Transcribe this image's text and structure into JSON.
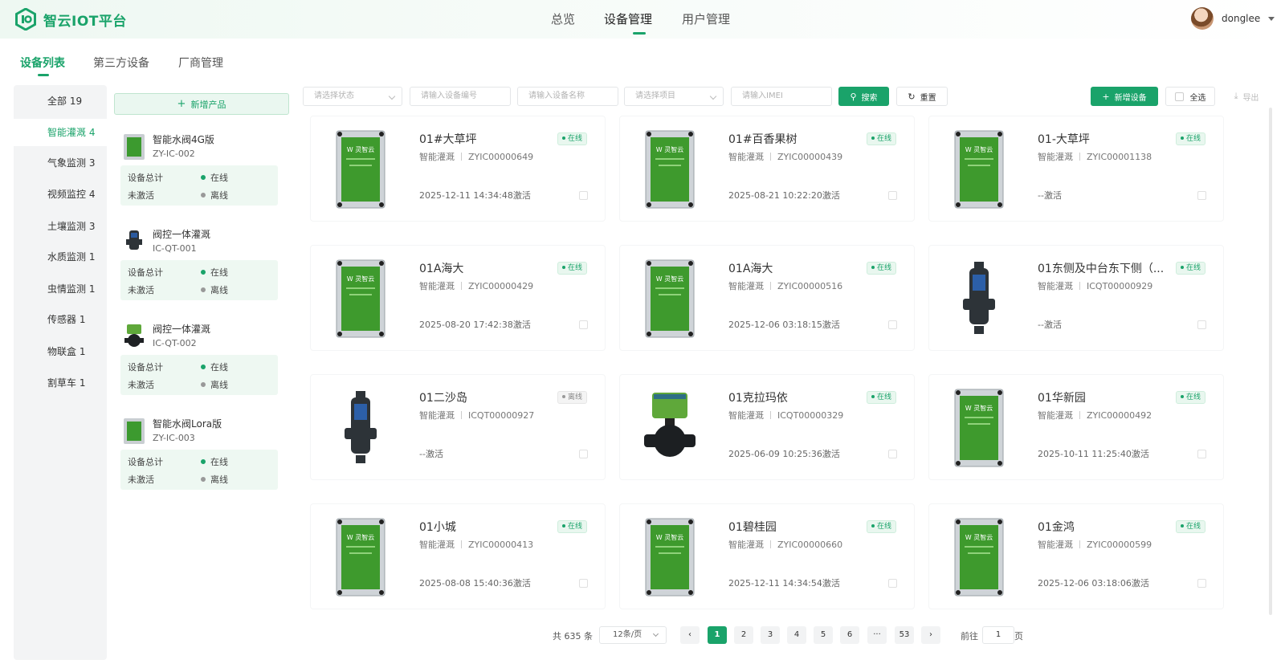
{
  "app": {
    "logo_text": "智云IOT平台",
    "accent": "#1aa36a"
  },
  "nav": {
    "items": [
      "总览",
      "设备管理",
      "用户管理"
    ],
    "active": "设备管理"
  },
  "user": {
    "name": "donglee"
  },
  "subtabs": {
    "items": [
      "设备列表",
      "第三方设备",
      "厂商管理"
    ],
    "active": "设备列表"
  },
  "categories": [
    {
      "label": "全部 19"
    },
    {
      "label": "智能灌溉 4",
      "active": true
    },
    {
      "label": "气象监测 3"
    },
    {
      "label": "视频监控 4"
    },
    {
      "label": "土壤监测 3"
    },
    {
      "label": "水质监测 1"
    },
    {
      "label": "虫情监测 1"
    },
    {
      "label": "传感器 1"
    },
    {
      "label": "物联盒 1"
    },
    {
      "label": "割草车 1"
    }
  ],
  "products": {
    "add_label": "新增产品",
    "items": [
      {
        "name": "智能水阀4G版",
        "code": "ZY-IC-002",
        "total_label": "设备总计",
        "inactive_label": "未激活",
        "online_label": "在线",
        "offline_label": "离线",
        "icon": "controller-box-icon"
      },
      {
        "name": "阀控一体灌溉",
        "code": "IC-QT-001",
        "total_label": "设备总计",
        "inactive_label": "未激活",
        "online_label": "在线",
        "offline_label": "离线",
        "icon": "valve-icon"
      },
      {
        "name": "阀控一体灌溉",
        "code": "IC-QT-002",
        "total_label": "设备总计",
        "inactive_label": "未激活",
        "online_label": "在线",
        "offline_label": "离线",
        "icon": "ball-valve-icon"
      },
      {
        "name": "智能水阀Lora版",
        "code": "ZY-IC-003",
        "total_label": "设备总计",
        "inactive_label": "未激活",
        "online_label": "在线",
        "offline_label": "离线",
        "icon": "controller-box-icon"
      }
    ]
  },
  "filters": {
    "status_placeholder": "请选择状态",
    "device_no_placeholder": "请输入设备编号",
    "device_name_placeholder": "请输入设备名称",
    "project_placeholder": "请选择项目",
    "imei_placeholder": "请输入IMEI",
    "search_label": "搜索",
    "reset_label": "重置",
    "add_device_label": "新增设备",
    "select_all_label": "全选",
    "export_label": "导出"
  },
  "devices": [
    {
      "title": "01#大草坪",
      "category": "智能灌溉",
      "code": "ZYIC00000649",
      "activated": "2025-12-11 14:34:48激活",
      "status": "在线",
      "online": true,
      "image": "controller-box-icon"
    },
    {
      "title": "01#百香果树",
      "category": "智能灌溉",
      "code": "ZYIC00000439",
      "activated": "2025-08-21 10:22:20激活",
      "status": "在线",
      "online": true,
      "image": "controller-box-icon"
    },
    {
      "title": "01-大草坪",
      "category": "智能灌溉",
      "code": "ZYIC00001138",
      "activated": "--激活",
      "status": "在线",
      "online": true,
      "image": "controller-box-icon"
    },
    {
      "title": "01A海大",
      "category": "智能灌溉",
      "code": "ZYIC00000429",
      "activated": "2025-08-20 17:42:38激活",
      "status": "在线",
      "online": true,
      "image": "controller-box-icon"
    },
    {
      "title": "01A海大",
      "category": "智能灌溉",
      "code": "ZYIC00000516",
      "activated": "2025-12-06 03:18:15激活",
      "status": "在线",
      "online": true,
      "image": "controller-box-icon"
    },
    {
      "title": "01东侧及中台东下侧（...",
      "category": "智能灌溉",
      "code": "ICQT00000929",
      "activated": "--激活",
      "status": "在线",
      "online": true,
      "image": "valve-icon"
    },
    {
      "title": "01二沙岛",
      "category": "智能灌溉",
      "code": "ICQT00000927",
      "activated": "--激活",
      "status": "离线",
      "online": false,
      "image": "valve-icon"
    },
    {
      "title": "01克拉玛依",
      "category": "智能灌溉",
      "code": "ICQT00000329",
      "activated": "2025-06-09 10:25:36激活",
      "status": "在线",
      "online": true,
      "image": "ball-valve-icon"
    },
    {
      "title": "01华新园",
      "category": "智能灌溉",
      "code": "ZYIC00000492",
      "activated": "2025-10-11 11:25:40激活",
      "status": "在线",
      "online": true,
      "image": "controller-box-icon"
    },
    {
      "title": "01小城",
      "category": "智能灌溉",
      "code": "ZYIC00000413",
      "activated": "2025-08-08 15:40:36激活",
      "status": "在线",
      "online": true,
      "image": "controller-box-icon"
    },
    {
      "title": "01碧桂园",
      "category": "智能灌溉",
      "code": "ZYIC00000660",
      "activated": "2025-12-11 14:34:54激活",
      "status": "在线",
      "online": true,
      "image": "controller-box-icon"
    },
    {
      "title": "01金鸿",
      "category": "智能灌溉",
      "code": "ZYIC00000599",
      "activated": "2025-12-06 03:18:06激活",
      "status": "在线",
      "online": true,
      "image": "controller-box-icon"
    }
  ],
  "pagination": {
    "total": "共 635 条",
    "page_size": "12条/页",
    "pages": [
      "1",
      "2",
      "3",
      "4",
      "5",
      "6",
      "···",
      "53"
    ],
    "current": "1",
    "goto_label": "前往",
    "goto_value": "1",
    "page_suffix": "页"
  }
}
